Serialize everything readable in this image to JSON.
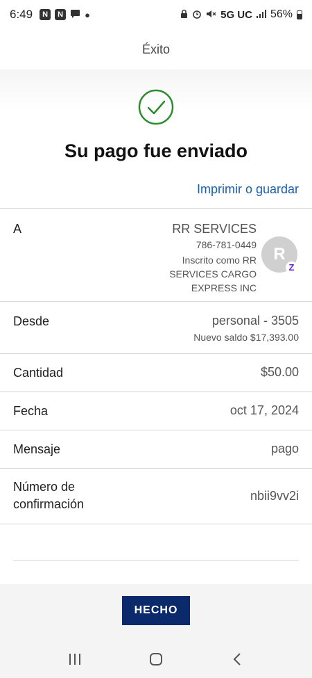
{
  "status_bar": {
    "time": "6:49",
    "network": "5G UC",
    "battery": "56%",
    "left_icons": [
      "n-app-icon",
      "n-app-icon",
      "chat-bubble-icon",
      "dot-icon"
    ],
    "right_icons": [
      "lock-icon",
      "alarm-icon",
      "mute-icon",
      "signal-icon",
      "battery-icon"
    ]
  },
  "header": {
    "title": "Éxito"
  },
  "hero": {
    "icon": "check-circle-icon",
    "headline": "Su pago fue enviado",
    "print_link": "Imprimir o guardar",
    "accent_color": "#2e8b2e"
  },
  "details": {
    "recipient": {
      "label": "A",
      "name": "RR SERVICES",
      "phone": "786-781-0449",
      "enrolled": "Inscrito como RR SERVICES CARGO EXPRESS INC",
      "avatar_initial": "R",
      "badge": "Z"
    },
    "from": {
      "label": "Desde",
      "value": "personal - 3505",
      "sub": "Nuevo saldo $17,393.00"
    },
    "amount": {
      "label": "Cantidad",
      "value": "$50.00"
    },
    "date": {
      "label": "Fecha",
      "value": "oct 17, 2024"
    },
    "message": {
      "label": "Mensaje",
      "value": "pago"
    },
    "confirmation": {
      "label": "Número de confirmación",
      "value": "nbii9vv2i"
    }
  },
  "actions": {
    "done_label": "HECHO",
    "button_color": "#0b2a6b"
  },
  "nav": {
    "recents": "recents-icon",
    "home": "home-icon",
    "back": "back-icon"
  }
}
